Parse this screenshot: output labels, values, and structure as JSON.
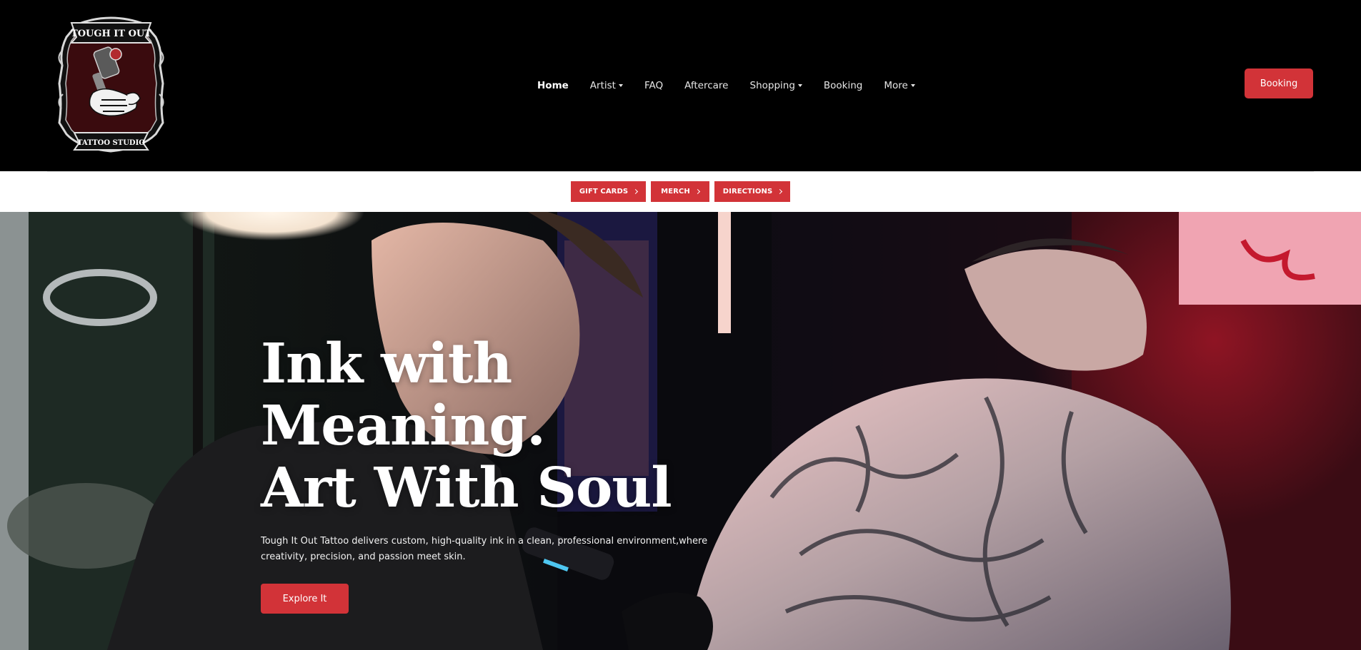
{
  "header": {
    "logo": {
      "top_text": "TOUGH IT OUT",
      "bottom_text": "TATTOO STUDIO",
      "icon": "tattoo-machine-skeleton-hand-logo"
    },
    "nav": [
      {
        "label": "Home",
        "active": true,
        "dropdown": false
      },
      {
        "label": "Artist",
        "active": false,
        "dropdown": true
      },
      {
        "label": "FAQ",
        "active": false,
        "dropdown": false
      },
      {
        "label": "Aftercare",
        "active": false,
        "dropdown": false
      },
      {
        "label": "Shopping",
        "active": false,
        "dropdown": true
      },
      {
        "label": "Booking",
        "active": false,
        "dropdown": false
      },
      {
        "label": "More",
        "active": false,
        "dropdown": true
      }
    ],
    "cta_label": "Booking"
  },
  "quick_links": [
    {
      "label": "GIFT CARDS",
      "icon": "chevron-right-icon"
    },
    {
      "label": "MERCH",
      "icon": "chevron-right-icon"
    },
    {
      "label": "DIRECTIONS",
      "icon": "chevron-right-icon"
    }
  ],
  "hero": {
    "title_line1": "Ink with Meaning.",
    "title_line2": "Art With Soul",
    "description": "Tough It Out Tattoo delivers custom, high-quality ink in a clean, professional environment,where creativity, precision, and passion meet skin.",
    "cta_label": "Explore It",
    "background": "photo of tattoo artist tattooing a client's back"
  },
  "colors": {
    "accent": "#d23338",
    "header_bg": "#000000",
    "strip_bg": "#ffffff"
  }
}
